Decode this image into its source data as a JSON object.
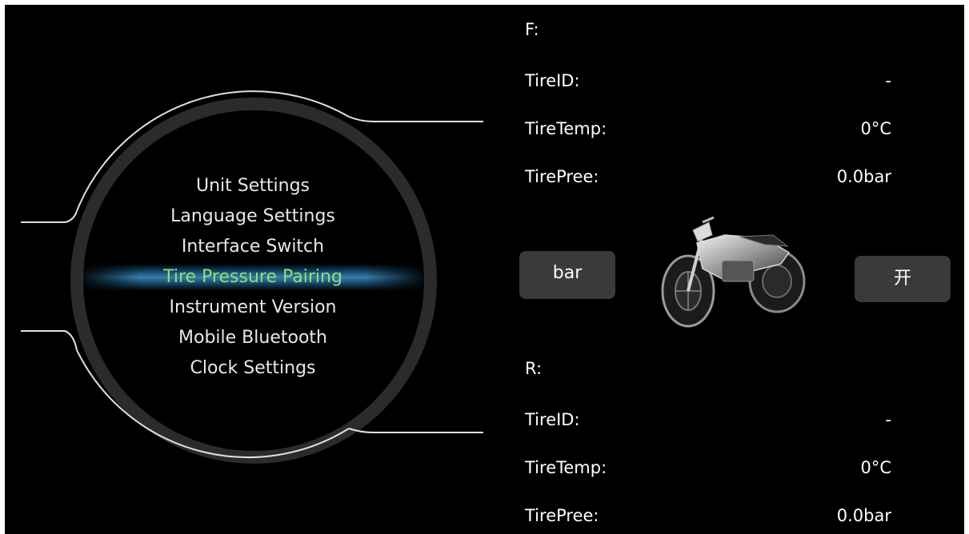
{
  "menu": {
    "items": [
      {
        "label": "Unit Settings",
        "selected": false
      },
      {
        "label": "Language Settings",
        "selected": false
      },
      {
        "label": "Interface Switch",
        "selected": false
      },
      {
        "label": "Tire Pressure Pairing",
        "selected": true
      },
      {
        "label": "Instrument Version",
        "selected": false
      },
      {
        "label": "Mobile Bluetooth",
        "selected": false
      },
      {
        "label": "Clock Settings",
        "selected": false
      }
    ],
    "highlight_color": "#8fe07a"
  },
  "front": {
    "header": "F:",
    "tire_id_label": "TireID:",
    "tire_id_value": "-",
    "tire_temp_label": "TireTemp:",
    "tire_temp_value": "0°C",
    "tire_pree_label": "TirePree:",
    "tire_pree_value": "0.0bar"
  },
  "rear": {
    "header": "R:",
    "tire_id_label": "TireID:",
    "tire_id_value": "-",
    "tire_temp_label": "TireTemp:",
    "tire_temp_value": "0°C",
    "tire_pree_label": "TirePree:",
    "tire_pree_value": "0.0bar"
  },
  "controls": {
    "unit_button_label": "bar",
    "toggle_button_label": "开"
  },
  "icons": {
    "vehicle": "motorcycle-icon"
  }
}
